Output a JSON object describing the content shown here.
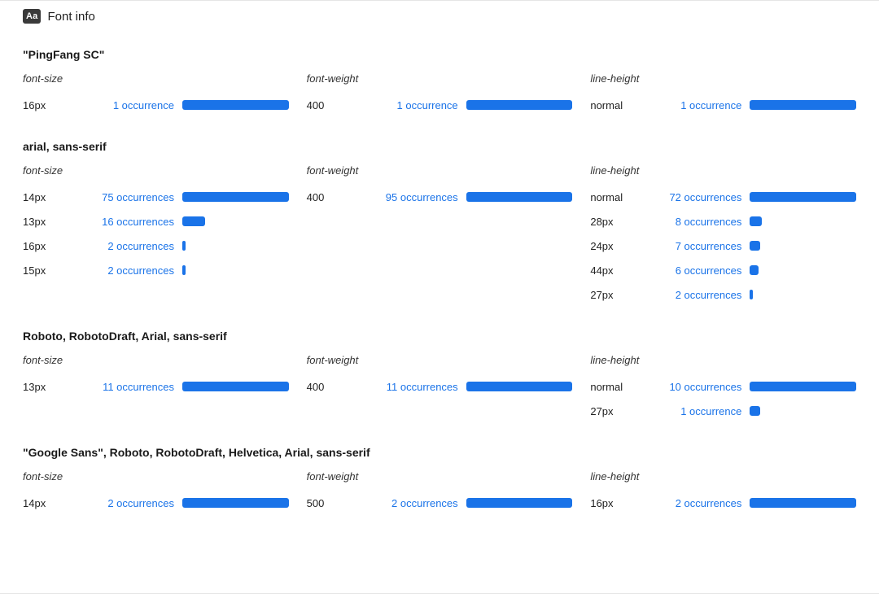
{
  "header": {
    "badge": "Aa",
    "title": "Font info"
  },
  "labels": {
    "font_size": "font-size",
    "font_weight": "font-weight",
    "line_height": "line-height"
  },
  "chart_data": {
    "type": "bar",
    "note": "Each value is a CSS metric bucket; count is number of occurrences. Bars scale count vs the local column maximum.",
    "fonts": [
      {
        "name": "\"PingFang SC\"",
        "font_size": [
          {
            "value": "16px",
            "count": 1,
            "label": "1 occurrence"
          }
        ],
        "font_weight": [
          {
            "value": "400",
            "count": 1,
            "label": "1 occurrence"
          }
        ],
        "line_height": [
          {
            "value": "normal",
            "count": 1,
            "label": "1 occurrence"
          }
        ]
      },
      {
        "name": "arial, sans-serif",
        "font_size": [
          {
            "value": "14px",
            "count": 75,
            "label": "75 occurrences"
          },
          {
            "value": "13px",
            "count": 16,
            "label": "16 occurrences"
          },
          {
            "value": "16px",
            "count": 2,
            "label": "2 occurrences"
          },
          {
            "value": "15px",
            "count": 2,
            "label": "2 occurrences"
          }
        ],
        "font_weight": [
          {
            "value": "400",
            "count": 95,
            "label": "95 occurrences"
          }
        ],
        "line_height": [
          {
            "value": "normal",
            "count": 72,
            "label": "72 occurrences"
          },
          {
            "value": "28px",
            "count": 8,
            "label": "8 occurrences"
          },
          {
            "value": "24px",
            "count": 7,
            "label": "7 occurrences"
          },
          {
            "value": "44px",
            "count": 6,
            "label": "6 occurrences"
          },
          {
            "value": "27px",
            "count": 2,
            "label": "2 occurrences"
          }
        ]
      },
      {
        "name": "Roboto, RobotoDraft, Arial, sans-serif",
        "font_size": [
          {
            "value": "13px",
            "count": 11,
            "label": "11 occurrences"
          }
        ],
        "font_weight": [
          {
            "value": "400",
            "count": 11,
            "label": "11 occurrences"
          }
        ],
        "line_height": [
          {
            "value": "normal",
            "count": 10,
            "label": "10 occurrences"
          },
          {
            "value": "27px",
            "count": 1,
            "label": "1 occurrence"
          }
        ]
      },
      {
        "name": "\"Google Sans\", Roboto, RobotoDraft, Helvetica, Arial, sans-serif",
        "font_size": [
          {
            "value": "14px",
            "count": 2,
            "label": "2 occurrences"
          }
        ],
        "font_weight": [
          {
            "value": "500",
            "count": 2,
            "label": "2 occurrences"
          }
        ],
        "line_height": [
          {
            "value": "16px",
            "count": 2,
            "label": "2 occurrences"
          }
        ]
      }
    ]
  }
}
